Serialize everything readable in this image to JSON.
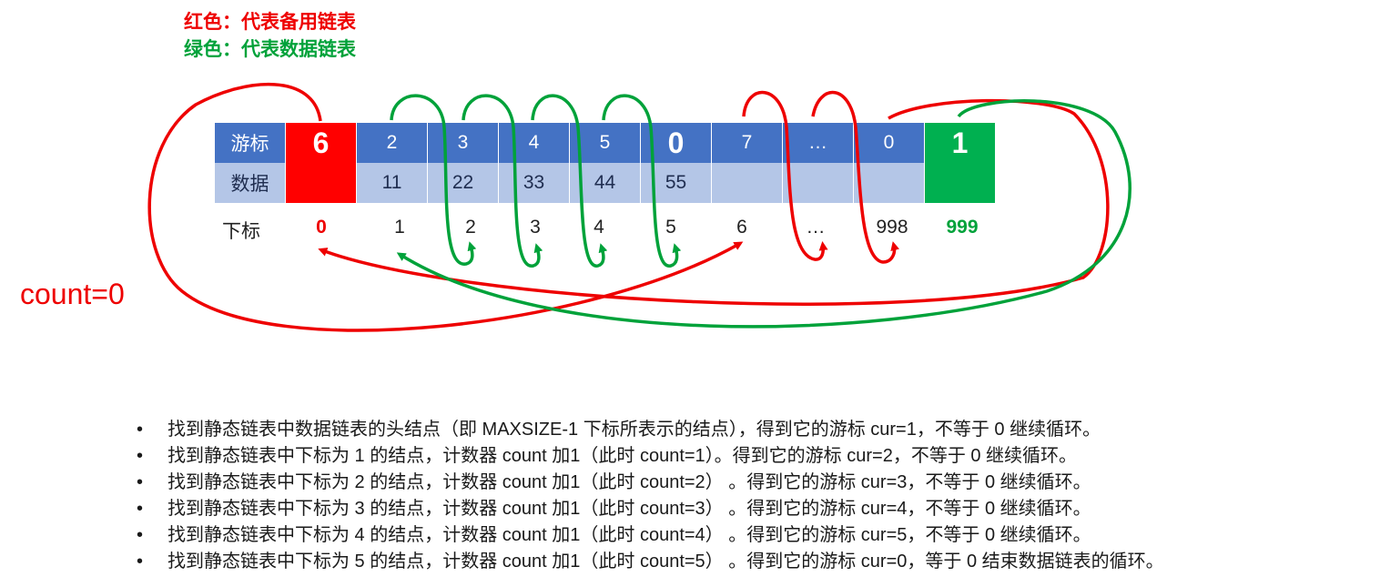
{
  "legend": {
    "red": "红色：代表备用链表",
    "green": "绿色：代表数据链表",
    "red_color": "#ee0000",
    "green_color": "#00a23a"
  },
  "table": {
    "cursor_header": "游标",
    "data_header": "数据",
    "index_header": "下标",
    "cursors": [
      "6",
      "2",
      "3",
      "4",
      "5",
      "0",
      "7",
      "…",
      "0",
      "1"
    ],
    "data": [
      "",
      "11",
      "22",
      "33",
      "44",
      "55",
      "",
      "",
      "",
      ""
    ],
    "indices": [
      "0",
      "1",
      "2",
      "3",
      "4",
      "5",
      "6",
      "…",
      "998",
      "999"
    ],
    "header_color": "#4472c4",
    "data_color": "#b4c6e7",
    "spare_head_color": "#ff0000",
    "data_head_color": "#00b050"
  },
  "counter": "count=0",
  "steps": [
    "找到静态链表中数据链表的头结点（即 MAXSIZE-1 下标所表示的结点），得到它的游标 cur=1，不等于 0 继续循环。",
    "找到静态链表中下标为 1 的结点，计数器 count 加1（此时 count=1）。得到它的游标 cur=2，不等于 0 继续循环。",
    "找到静态链表中下标为 2 的结点，计数器 count 加1（此时 count=2）  。得到它的游标 cur=3，不等于 0 继续循环。",
    "找到静态链表中下标为 3 的结点，计数器 count 加1（此时 count=3）  。得到它的游标 cur=4，不等于 0 继续循环。",
    "找到静态链表中下标为 4 的结点，计数器 count 加1（此时 count=4）  。得到它的游标 cur=5，不等于 0 继续循环。",
    "找到静态链表中下标为 5 的结点，计数器 count 加1（此时 count=5）  。得到它的游标 cur=0，等于 0 结束数据链表的循环。"
  ],
  "bullet_glyph": "•"
}
